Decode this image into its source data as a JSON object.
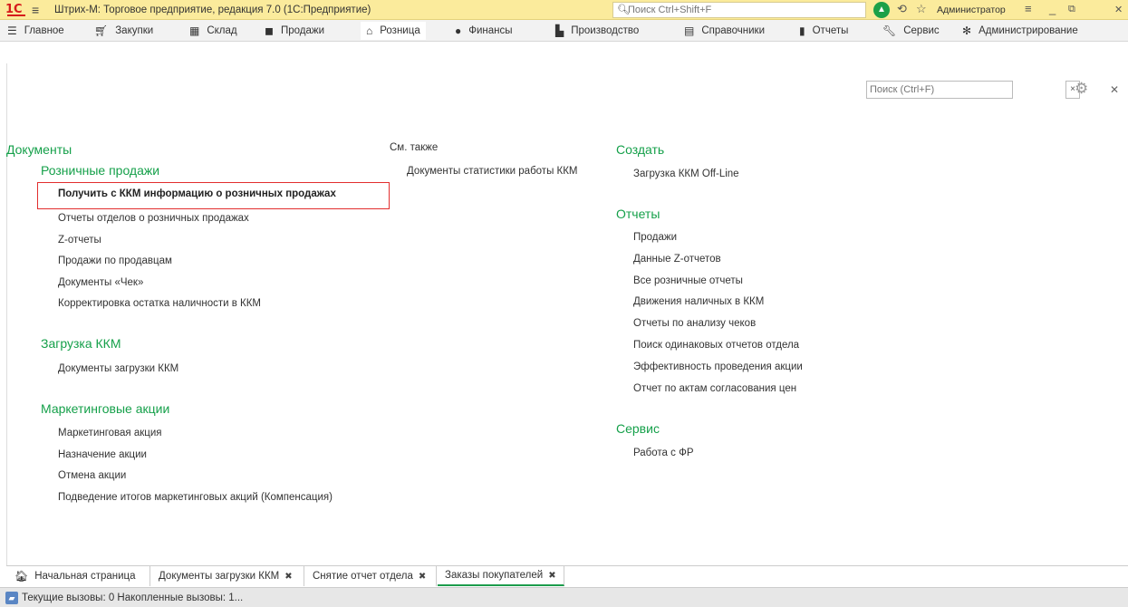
{
  "window": {
    "logo": "1С",
    "title": "Штрих-М: Торговое предприятие, редакция 7.0  (1С:Предприятие)",
    "search_placeholder": "Поиск Ctrl+Shift+F",
    "user": "Администратор",
    "notification_count": ""
  },
  "sections": [
    {
      "label": "Главное",
      "icon": "hamburger-icon"
    },
    {
      "label": "Закупки",
      "icon": "cart-icon"
    },
    {
      "label": "Склад",
      "icon": "warehouse-icon"
    },
    {
      "label": "Продажи",
      "icon": "bag-icon"
    },
    {
      "label": "Розница",
      "icon": "store-icon"
    },
    {
      "label": "Финансы",
      "icon": "ruble-icon"
    },
    {
      "label": "Производство",
      "icon": "factory-icon"
    },
    {
      "label": "Справочники",
      "icon": "book-icon"
    },
    {
      "label": "Отчеты",
      "icon": "bar-chart-icon"
    },
    {
      "label": "Сервис",
      "icon": "wrench-icon"
    },
    {
      "label": "Администрирование",
      "icon": "gear-icon"
    }
  ],
  "pane": {
    "search_placeholder": "Поиск (Ctrl+F)",
    "documents": {
      "title": "Документы",
      "retail": {
        "title": "Розничные продажи",
        "items": [
          "Получить с ККМ информацию о розничных продажах",
          "Отчеты отделов о розничных продажах",
          "Z-отчеты",
          "Продажи по продавцам",
          "Документы «Чек»",
          "Корректировка остатка наличности в ККМ"
        ]
      },
      "kkm_load": {
        "title": "Загрузка ККМ",
        "items": [
          "Документы загрузки ККМ"
        ]
      },
      "marketing": {
        "title": "Маркетинговые акции",
        "items": [
          "Маркетинговая акция",
          "Назначение акции",
          "Отмена акции",
          "Подведение итогов маркетинговых акций (Компенсация)"
        ]
      }
    },
    "see_also": {
      "title": "См. также",
      "items": [
        "Документы статистики работы ККМ"
      ]
    },
    "create": {
      "title": "Создать",
      "items": [
        "Загрузка ККМ Off-Line"
      ]
    },
    "reports": {
      "title": "Отчеты",
      "items": [
        "Продажи",
        "Данные Z-отчетов",
        "Все розничные отчеты",
        "Движения наличных в ККМ",
        "Отчеты по анализу чеков",
        "Поиск одинаковых отчетов отдела",
        "Эффективность проведения акции",
        "Отчет по актам согласования цен"
      ]
    },
    "service": {
      "title": "Сервис",
      "items": [
        "Работа с ФР"
      ]
    }
  },
  "tabs": [
    {
      "label": "Начальная страница"
    },
    {
      "label": "Документы загрузки ККМ"
    },
    {
      "label": "Снятие отчет отдела"
    },
    {
      "label": "Заказы покупателей"
    }
  ],
  "status": {
    "text": "Текущие вызовы: 0   Накопленные вызовы: 1..."
  },
  "colors": {
    "title_bar": "#fbeb9c",
    "accent_green": "#15a04a",
    "highlight_red": "#e22e2e"
  }
}
